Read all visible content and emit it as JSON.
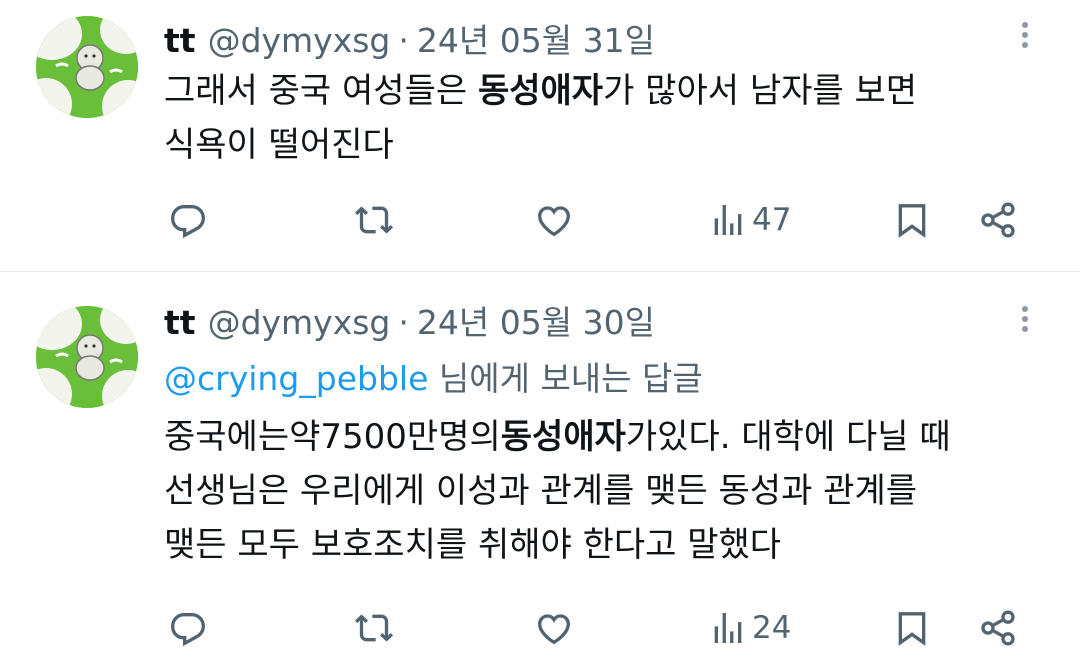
{
  "tweets": [
    {
      "name": "tt",
      "handle": "@dymyxsg",
      "dot": "·",
      "date": "24년 05월 31일",
      "body": {
        "line1_pre": "그래서 중국 여성들은 ",
        "line1_bold": "동성애자",
        "line1_post": "가 많아서 남자를 보면",
        "line2": "식욕이 떨어진다"
      },
      "actions": {
        "views_count": "47"
      }
    },
    {
      "name": "tt",
      "handle": "@dymyxsg",
      "dot": "·",
      "date": "24년 05월 30일",
      "reply_to": {
        "mention": "@crying_pebble",
        "suffix": " 님에게 보내는 답글"
      },
      "body": {
        "line1_pre": "중국에는약7500만명의",
        "line1_bold": "동성애자",
        "line1_post": "가있다. 대학에 다닐 때",
        "line2": "선생님은 우리에게 이성과 관계를 맺든 동성과 관계를",
        "line3": "맺든 모두 보호조치를 취해야 한다고 말했다"
      },
      "actions": {
        "views_count": "24"
      }
    }
  ],
  "colors": {
    "text": "#0f1419",
    "secondary": "#536471",
    "mention": "#1d9bf0",
    "divider": "#e4e6e8",
    "avatar_green": "#6abf3a"
  },
  "icons": [
    "reply-icon",
    "retweet-icon",
    "like-icon",
    "views-icon",
    "bookmark-icon",
    "share-icon",
    "more-icon"
  ]
}
